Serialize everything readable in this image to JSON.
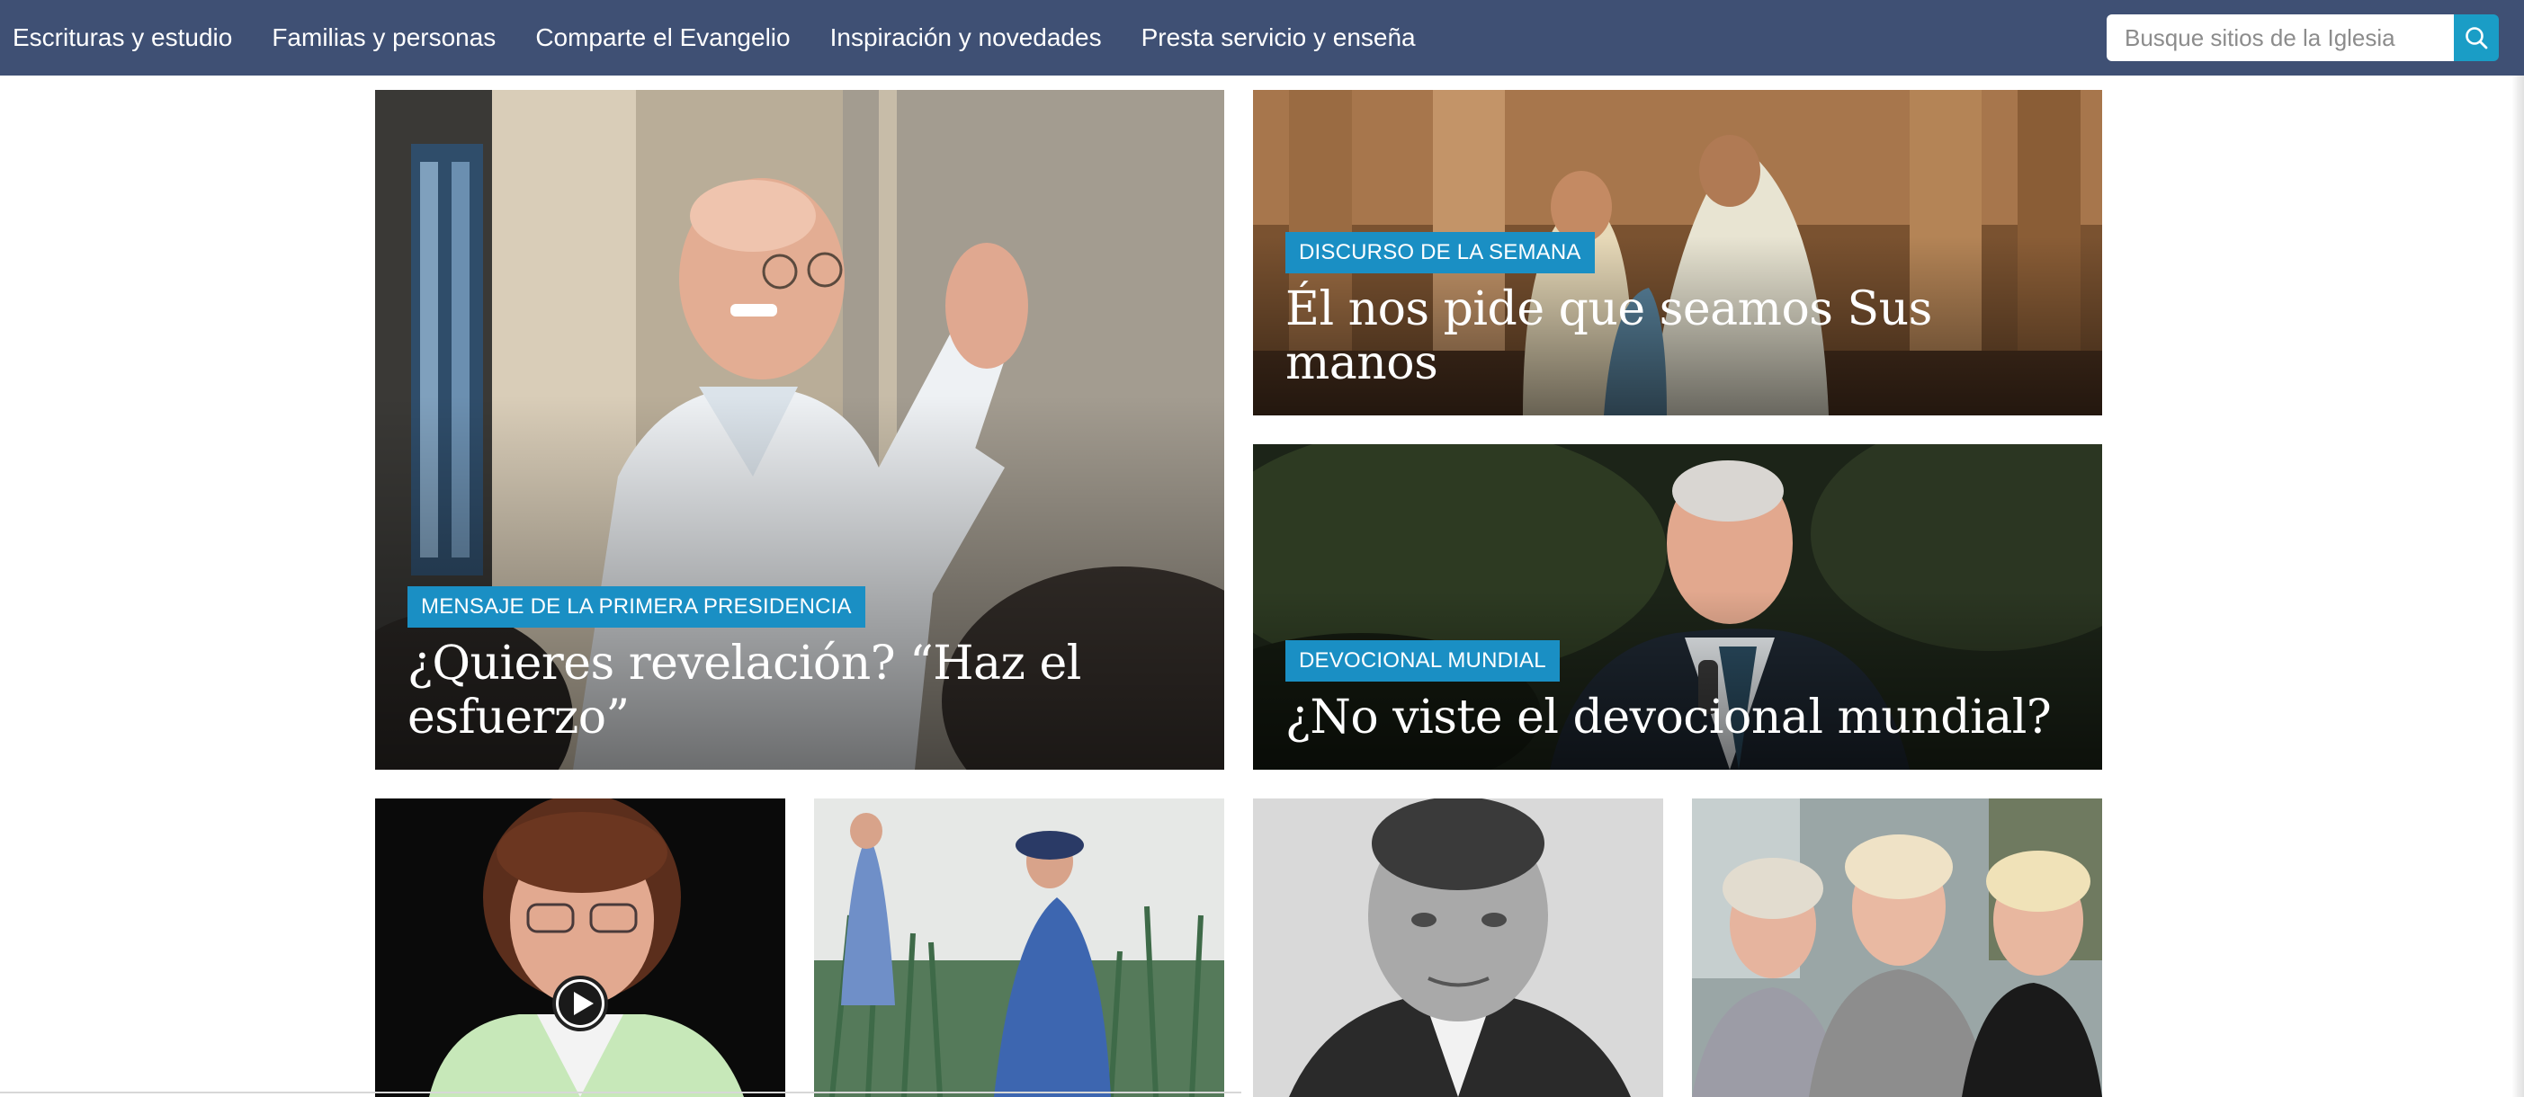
{
  "nav": {
    "links": [
      "Escrituras y estudio",
      "Familias y personas",
      "Comparte el Evangelio",
      "Inspiración y novedades",
      "Presta servicio y enseña"
    ],
    "search_placeholder": "Busque sitios de la Iglesia",
    "search_icon": "search-icon",
    "background_color": "#3f5074",
    "accent_color": "#1a9dc6"
  },
  "features": {
    "main": {
      "tag": "MENSAJE DE LA PRIMERA PRESIDENCIA",
      "title": "¿Quieres revelación? “Haz el esfuerzo”"
    },
    "right_top": {
      "tag": "DISCURSO DE LA SEMANA",
      "title": "Él nos pide que seamos Sus manos"
    },
    "right_bottom": {
      "tag": "DEVOCIONAL MUNDIAL",
      "title": "¿No viste el devocional mundial?"
    }
  },
  "tiles": {
    "video_icon": "play-icon"
  },
  "tag_color": "#1a8fc4"
}
